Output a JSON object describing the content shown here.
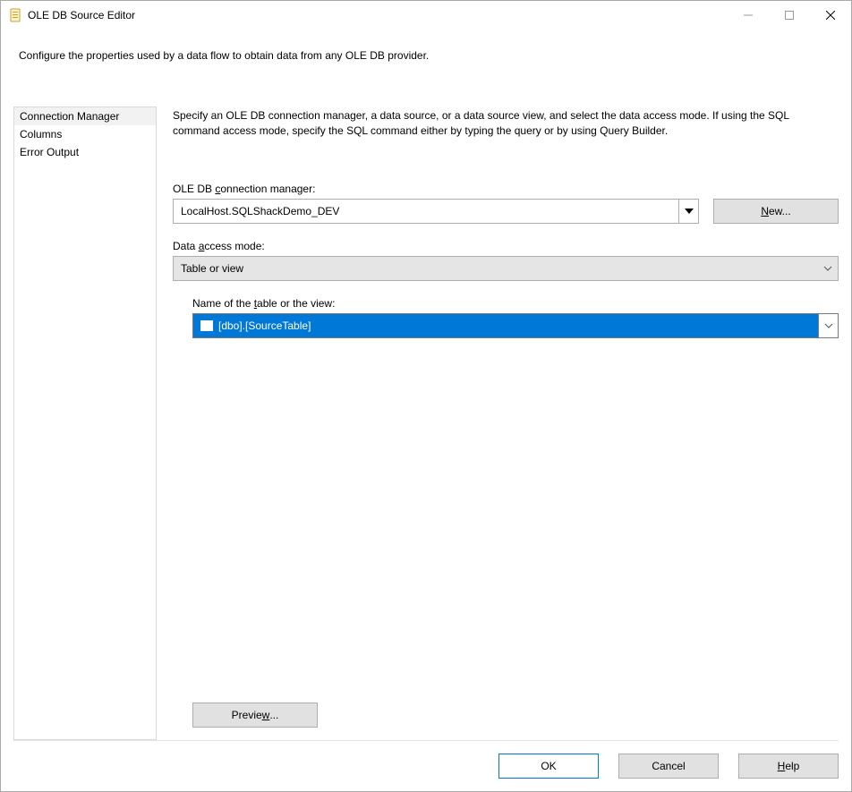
{
  "window": {
    "title": "OLE DB Source Editor"
  },
  "description": "Configure the properties used by a data flow to obtain data from any OLE DB provider.",
  "sidebar": {
    "items": [
      {
        "label": "Connection Manager",
        "selected": true
      },
      {
        "label": "Columns",
        "selected": false
      },
      {
        "label": "Error Output",
        "selected": false
      }
    ]
  },
  "panel": {
    "instructions": "Specify an OLE DB connection manager, a data source, or a data source view, and select the data access mode. If using the SQL command access mode, specify the SQL command either by typing the query or by using Query Builder.",
    "conn_label_prefix": "OLE DB ",
    "conn_label_ul": "c",
    "conn_label_suffix": "onnection manager:",
    "conn_value": "LocalHost.SQLShackDemo_DEV",
    "new_button_ul": "N",
    "new_button_suffix": "ew...",
    "access_label_prefix": "Data ",
    "access_label_ul": "a",
    "access_label_suffix": "ccess mode:",
    "access_value": "Table or view",
    "table_label_prefix": "Name of the ",
    "table_label_ul": "t",
    "table_label_suffix": "able or the view:",
    "table_value": "[dbo].[SourceTable]",
    "preview_prefix": "Previe",
    "preview_ul": "w",
    "preview_suffix": "..."
  },
  "buttons": {
    "ok": "OK",
    "cancel": "Cancel",
    "help_ul": "H",
    "help_suffix": "elp"
  }
}
